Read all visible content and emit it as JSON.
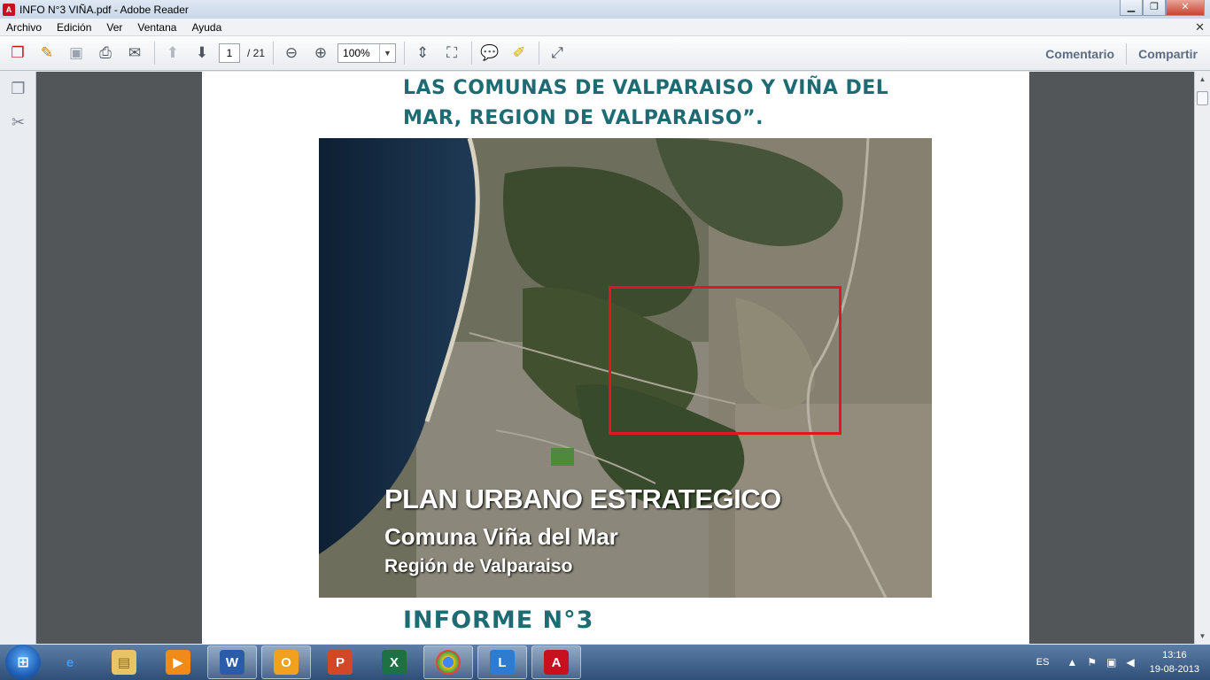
{
  "window": {
    "title": "INFO N°3 VIÑA.pdf - Adobe Reader"
  },
  "menu": [
    "Archivo",
    "Edición",
    "Ver",
    "Ventana",
    "Ayuda"
  ],
  "toolbar": {
    "page_current": "1",
    "page_total": "/ 21",
    "zoom": "100%",
    "comentario": "Comentario",
    "compartir": "Compartir"
  },
  "document": {
    "heading_line1": "LAS COMUNAS DE VALPARAISO Y VIÑA DEL",
    "heading_line2": "MAR, REGION DE VALPARAISO”.",
    "map_title": "PLAN URBANO ESTRATEGICO",
    "map_subtitle": "Comuna Viña del Mar",
    "map_region": "Región de Valparaiso",
    "informe": "INFORME N°3"
  },
  "taskbar": {
    "lang": "ES",
    "time": "13:16",
    "date": "19-08-2013"
  },
  "colors": {
    "heading": "#1f6b73",
    "highlight_box": "#e4161b",
    "doc_background": "#525659"
  }
}
